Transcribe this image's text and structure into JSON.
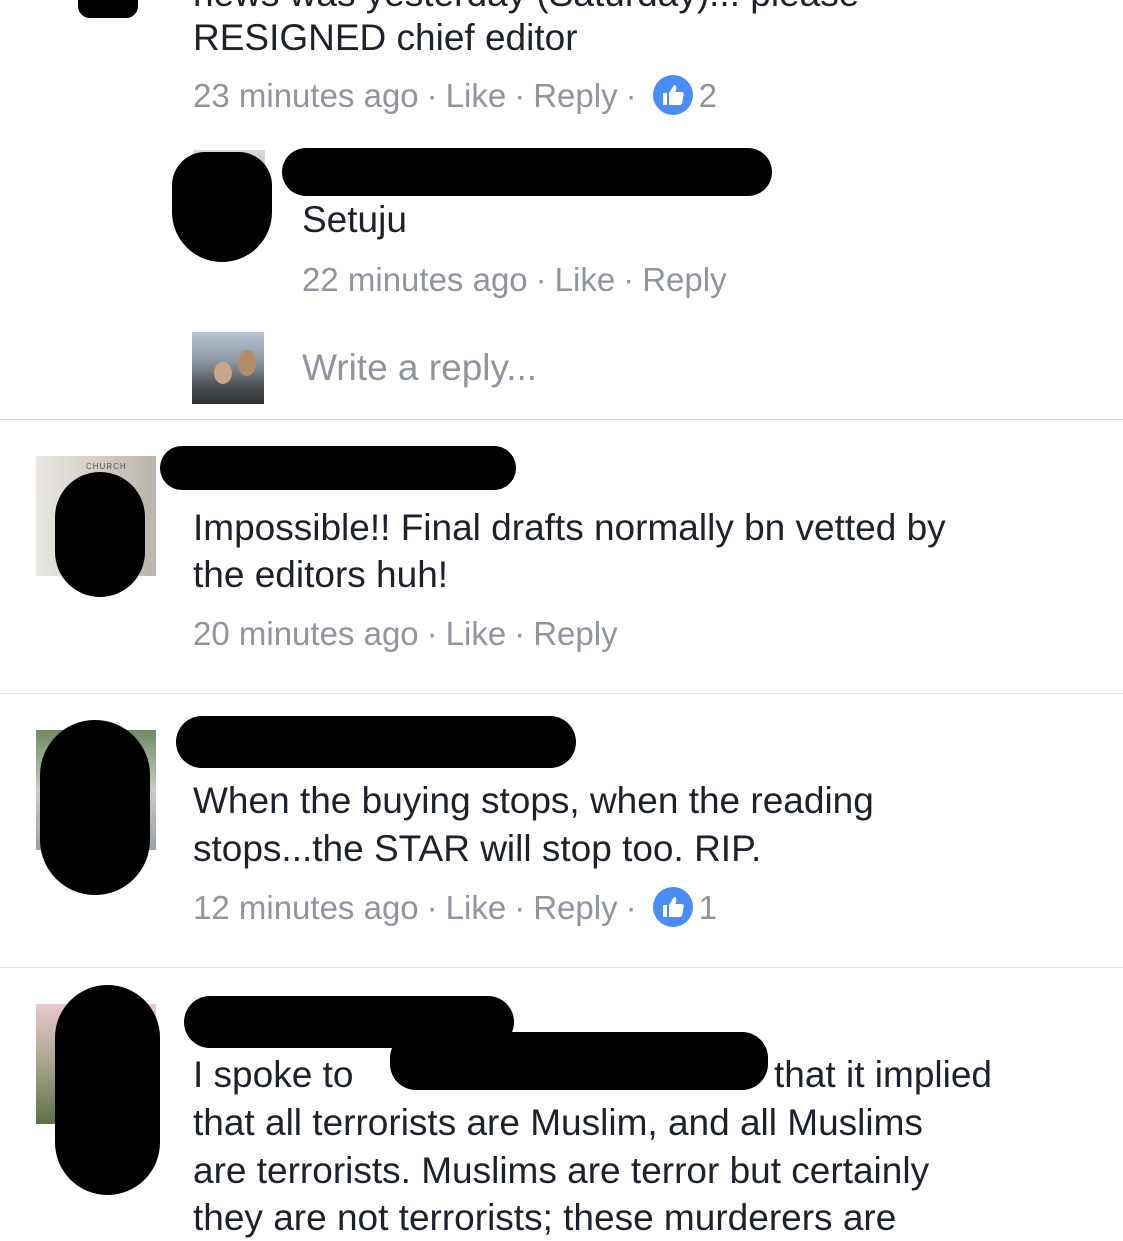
{
  "comment_top": {
    "text_line_partial": "news was yesterday (Saturday)... please",
    "text_line": "RESIGNED chief editor",
    "time": "23 minutes ago",
    "like": "Like",
    "reply": "Reply",
    "like_count": "2"
  },
  "reply_1": {
    "text": "Setuju",
    "time": "22 minutes ago",
    "like": "Like",
    "reply": "Reply"
  },
  "reply_box": {
    "placeholder": "Write a reply..."
  },
  "comment_2": {
    "line1": "Impossible!! Final drafts normally bn vetted by",
    "line2": "the editors huh!",
    "time": "20 minutes ago",
    "like": "Like",
    "reply": "Reply"
  },
  "comment_3": {
    "line1": "When the buying stops, when the reading",
    "line2": "stops...the STAR will stop too. RIP.",
    "time": "12 minutes ago",
    "like": "Like",
    "reply": "Reply",
    "like_count": "1"
  },
  "comment_4": {
    "line1_a": "I spoke to",
    "line1_b": "that it implied",
    "line2": "that all terrorists are Muslim, and all Muslims",
    "line3": "are terrorists. Muslims are terror but certainly",
    "line4": "they are not terrorists; these murderers are"
  },
  "colors": {
    "meta_gray": "#90949c",
    "like_blue": "#4a8df8",
    "divider": "#dddfe2"
  }
}
